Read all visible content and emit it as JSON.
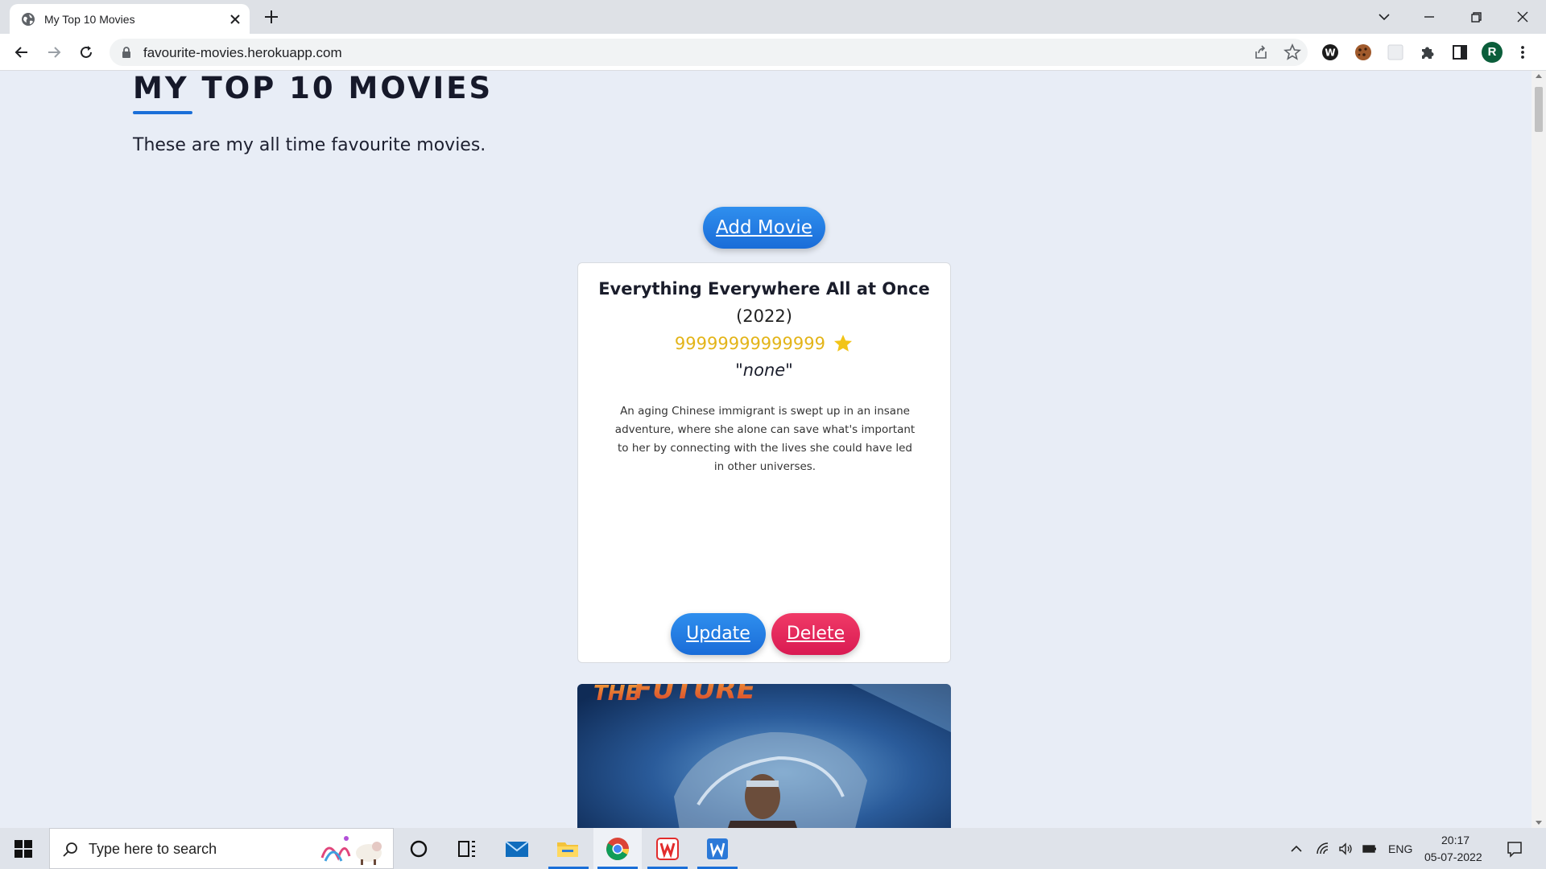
{
  "browser": {
    "tab_title": "My Top 10 Movies",
    "url": "favourite-movies.herokuapp.com",
    "profile_initial": "R"
  },
  "page": {
    "heading": "MY TOP 10 MOVIES",
    "intro": "These are my all time favourite movies.",
    "add_button": "Add Movie"
  },
  "movies": [
    {
      "title": "Everything Everywhere All at Once",
      "year": "(2022)",
      "rating": "99999999999999",
      "review": "\"none\"",
      "description": "An aging Chinese immigrant is swept up in an insane adventure, where she alone can save what's important to her by connecting with the lives she could have led in other universes.",
      "update_label": "Update",
      "delete_label": "Delete"
    }
  ],
  "taskbar": {
    "search_placeholder": "Type here to search",
    "language": "ENG",
    "time": "20:17",
    "date": "05-07-2022"
  },
  "colors": {
    "accent_blue": "#1a6fd8",
    "delete_red": "#e8245a",
    "rating_gold": "#e3b418",
    "page_bg": "#e8edf6"
  }
}
